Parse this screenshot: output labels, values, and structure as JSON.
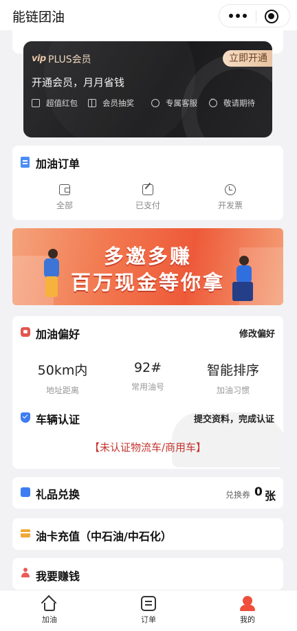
{
  "app_title": "能链团油",
  "vip": {
    "logo": "vip",
    "title": "PLUS会员",
    "cta": "立即开通",
    "slogan": "开通会员，月月省钱",
    "benefits": [
      "超值红包",
      "会员抽奖",
      "专属客服",
      "敬请期待"
    ]
  },
  "orders": {
    "title": "加油订单",
    "items": [
      "全部",
      "已支付",
      "开发票"
    ]
  },
  "banner": {
    "line1": "多邀多赚",
    "line2": "百万现金等你拿"
  },
  "preference": {
    "title": "加油偏好",
    "action": "修改偏好",
    "stats": [
      {
        "value": "50km内",
        "label": "地址距离"
      },
      {
        "value": "92#",
        "label": "常用油号"
      },
      {
        "value": "智能排序",
        "label": "加油习惯"
      }
    ]
  },
  "vehicle": {
    "title": "车辆认证",
    "action": "提交资料，完成认证",
    "note": "【未认证物流车/商用车】"
  },
  "gift": {
    "title": "礼品兑换",
    "coupon_label": "兑换券",
    "coupon_count": "0",
    "coupon_unit": "张"
  },
  "fuel_card": {
    "title": "油卡充值（中石油/中石化）"
  },
  "earn": {
    "title": "我要赚钱"
  },
  "tabbar": {
    "home": "加油",
    "orders": "订单",
    "me": "我的"
  },
  "colors": {
    "accent": "#ee4e3a",
    "vip_gold": "#e7c3a2",
    "link_blue": "#3d7cf3",
    "alert_red": "#c2352f"
  }
}
